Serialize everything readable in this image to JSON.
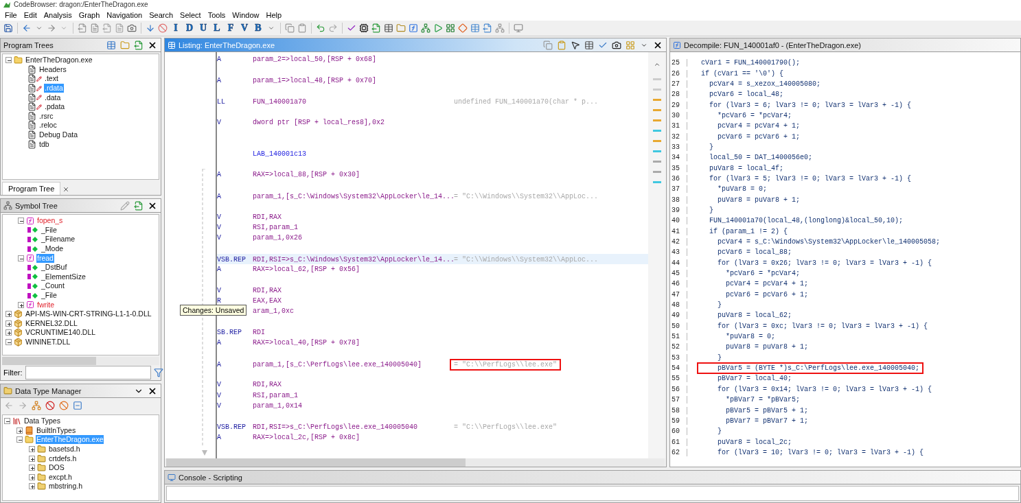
{
  "window": {
    "title": "CodeBrowser: dragon:/EnterTheDragon.exe"
  },
  "menu": [
    "File",
    "Edit",
    "Analysis",
    "Graph",
    "Navigation",
    "Search",
    "Select",
    "Tools",
    "Window",
    "Help"
  ],
  "toolbar_letters": [
    "I",
    "D",
    "U",
    "L",
    "F",
    "V",
    "B"
  ],
  "program_trees": {
    "title": "Program Trees",
    "tab": "Program Tree",
    "nodes": [
      {
        "label": "EnterTheDragon.exe",
        "kind": "program",
        "expanded": true,
        "selected": false,
        "children": [
          {
            "label": "Headers",
            "kind": "fragment",
            "flagged": false,
            "selected": false
          },
          {
            "label": ".text",
            "kind": "fragment",
            "flagged": true,
            "selected": false
          },
          {
            "label": ".rdata",
            "kind": "fragment",
            "flagged": true,
            "selected": true
          },
          {
            "label": ".data",
            "kind": "fragment",
            "flagged": true,
            "selected": false
          },
          {
            "label": ".pdata",
            "kind": "fragment",
            "flagged": true,
            "selected": false
          },
          {
            "label": ".rsrc",
            "kind": "fragment",
            "flagged": false,
            "selected": false
          },
          {
            "label": ".reloc",
            "kind": "fragment",
            "flagged": false,
            "selected": false
          },
          {
            "label": "Debug Data",
            "kind": "fragment",
            "flagged": false,
            "selected": false
          },
          {
            "label": "tdb",
            "kind": "fragment",
            "flagged": false,
            "selected": false
          }
        ]
      }
    ]
  },
  "symbol_tree": {
    "title": "Symbol Tree",
    "filter_label": "Filter:",
    "nodes": [
      {
        "label": "fopen_s",
        "kind": "function",
        "expanded": true,
        "selected": false,
        "children": [
          {
            "label": "_File",
            "kind": "parameter",
            "selected": false
          },
          {
            "label": "_Filename",
            "kind": "parameter",
            "selected": false
          },
          {
            "label": "_Mode",
            "kind": "parameter",
            "selected": false
          }
        ]
      },
      {
        "label": "fread",
        "kind": "function",
        "expanded": true,
        "selected": true,
        "children": [
          {
            "label": "_DstBuf",
            "kind": "parameter",
            "selected": false
          },
          {
            "label": "_ElementSize",
            "kind": "parameter",
            "selected": false
          },
          {
            "label": "_Count",
            "kind": "parameter",
            "selected": false
          },
          {
            "label": "_File",
            "kind": "parameter",
            "selected": false
          }
        ]
      },
      {
        "label": "fwrite",
        "kind": "function",
        "expanded": false,
        "selected": false
      },
      {
        "label": "API-MS-WIN-CRT-STRING-L1-1-0.DLL",
        "kind": "library",
        "expanded": false,
        "selected": false
      },
      {
        "label": "KERNEL32.DLL",
        "kind": "library",
        "expanded": false,
        "selected": false
      },
      {
        "label": "VCRUNTIME140.DLL",
        "kind": "library",
        "expanded": false,
        "selected": false
      },
      {
        "label": "WININET.DLL",
        "kind": "library",
        "expanded": true,
        "selected": false
      }
    ]
  },
  "data_type_manager": {
    "title": "Data Type Manager",
    "nodes": [
      {
        "label": "Data Types",
        "kind": "root",
        "expanded": true,
        "selected": false,
        "children": [
          {
            "label": "BuiltInTypes",
            "kind": "archive",
            "expanded": false,
            "selected": false
          },
          {
            "label": "EnterTheDragon.exe",
            "kind": "program",
            "expanded": true,
            "selected": true,
            "children": [
              {
                "label": "basetsd.h",
                "kind": "folder",
                "expanded": false,
                "selected": false
              },
              {
                "label": "crtdefs.h",
                "kind": "folder",
                "expanded": false,
                "selected": false
              },
              {
                "label": "DOS",
                "kind": "folder",
                "expanded": false,
                "selected": false
              },
              {
                "label": "excpt.h",
                "kind": "folder",
                "expanded": false,
                "selected": false
              },
              {
                "label": "mbstring.h",
                "kind": "folder",
                "expanded": false,
                "selected": false
              }
            ]
          }
        ]
      }
    ]
  },
  "listing": {
    "title": "Listing:  EnterTheDragon.exe",
    "tooltip": "Changes: Unsaved",
    "rows": [
      {
        "kind": "code",
        "mnemonic": "A",
        "operands": "param_2=>local_50,[RSP + 0x68]",
        "current": false
      },
      {
        "kind": "blank"
      },
      {
        "kind": "code",
        "mnemonic": "A",
        "operands": "param_1=>local_48,[RSP + 0x70]",
        "current": false
      },
      {
        "kind": "blank"
      },
      {
        "kind": "code",
        "mnemonic": "LL",
        "operands": "FUN_140001a70",
        "comment": "undefined FUN_140001a70(char * p...",
        "current": false
      },
      {
        "kind": "blank"
      },
      {
        "kind": "code",
        "mnemonic": "V",
        "operands": "dword ptr [RSP + local_res8],0x2",
        "current": false
      },
      {
        "kind": "blank"
      },
      {
        "kind": "blank"
      },
      {
        "kind": "label",
        "operands": "LAB_140001c13",
        "current": false
      },
      {
        "kind": "blank"
      },
      {
        "kind": "code",
        "mnemonic": "A",
        "operands": "RAX=>local_88,[RSP + 0x30]",
        "current": false
      },
      {
        "kind": "blank"
      },
      {
        "kind": "code",
        "mnemonic": "A",
        "operands": "param_1,[s_C:\\Windows\\System32\\AppLocker\\le_14...",
        "comment": "= \"C:\\\\Windows\\\\System32\\\\AppLoc...",
        "current": false
      },
      {
        "kind": "blank"
      },
      {
        "kind": "code",
        "mnemonic": "V",
        "operands": "RDI,RAX",
        "current": false
      },
      {
        "kind": "code",
        "mnemonic": "V",
        "operands": "RSI,param_1",
        "current": false
      },
      {
        "kind": "code",
        "mnemonic": "V",
        "operands": "param_1,0x26",
        "current": false
      },
      {
        "kind": "blank"
      },
      {
        "kind": "code",
        "mnemonic": "VSB.REP",
        "operands": "RDI,RSI=>s_C:\\Windows\\System32\\AppLocker\\le_14...",
        "comment": "= \"C:\\\\Windows\\\\System32\\\\AppLoc...",
        "current": true
      },
      {
        "kind": "code",
        "mnemonic": "A",
        "operands": "RAX=>local_62,[RSP + 0x56]",
        "current": false
      },
      {
        "kind": "blank"
      },
      {
        "kind": "code",
        "mnemonic": "V",
        "operands": "RDI,RAX",
        "current": false
      },
      {
        "kind": "code",
        "mnemonic": "R",
        "operands": "EAX,EAX",
        "current": false
      },
      {
        "kind": "code",
        "operands": "aram_1,0xc",
        "current": false
      },
      {
        "kind": "blank"
      },
      {
        "kind": "code",
        "mnemonic": "SB.REP",
        "operands": "RDI",
        "current": false
      },
      {
        "kind": "code",
        "mnemonic": "A",
        "operands": "RAX=>local_40,[RSP + 0x78]",
        "current": false
      },
      {
        "kind": "blank"
      },
      {
        "kind": "code",
        "mnemonic": "A",
        "operands": "param_1,[s_C:\\PerfLogs\\lee.exe_140005040]",
        "comment": "= \"C:\\\\PerfLogs\\\\lee.exe\"",
        "boxed": true,
        "current": false
      },
      {
        "kind": "blank"
      },
      {
        "kind": "code",
        "mnemonic": "V",
        "operands": "RDI,RAX",
        "current": false
      },
      {
        "kind": "code",
        "mnemonic": "V",
        "operands": "RSI,param_1",
        "current": false
      },
      {
        "kind": "code",
        "mnemonic": "V",
        "operands": "param_1,0x14",
        "current": false
      },
      {
        "kind": "blank"
      },
      {
        "kind": "code",
        "mnemonic": "VSB.REP",
        "operands": "RDI,RSI=>s_C:\\PerfLogs\\lee.exe_140005040",
        "comment": "= \"C:\\\\PerfLogs\\\\lee.exe\"",
        "current": false
      },
      {
        "kind": "code",
        "mnemonic": "A",
        "operands": "RAX=>local_2c,[RSP + 0x8c]",
        "current": false
      }
    ]
  },
  "decompile": {
    "title": "Decompile: FUN_140001af0 -  (EnterTheDragon.exe)",
    "lines": [
      {
        "n": "25",
        "code": "cVar1 = FUN_140001790();"
      },
      {
        "n": "26",
        "code": "if (cVar1 == '\\0') {"
      },
      {
        "n": "27",
        "code": "  pcVar4 = s_xezox_140005080;"
      },
      {
        "n": "28",
        "code": "  pcVar6 = local_48;"
      },
      {
        "n": "29",
        "code": "  for (lVar3 = 6; lVar3 != 0; lVar3 = lVar3 + -1) {"
      },
      {
        "n": "30",
        "code": "    *pcVar6 = *pcVar4;"
      },
      {
        "n": "31",
        "code": "    pcVar4 = pcVar4 + 1;"
      },
      {
        "n": "32",
        "code": "    pcVar6 = pcVar6 + 1;"
      },
      {
        "n": "33",
        "code": "  }"
      },
      {
        "n": "34",
        "code": "  local_50 = DAT_1400056e0;"
      },
      {
        "n": "35",
        "code": "  puVar8 = local_4f;"
      },
      {
        "n": "36",
        "code": "  for (lVar3 = 5; lVar3 != 0; lVar3 = lVar3 + -1) {"
      },
      {
        "n": "37",
        "code": "    *puVar8 = 0;"
      },
      {
        "n": "38",
        "code": "    puVar8 = puVar8 + 1;"
      },
      {
        "n": "39",
        "code": "  }"
      },
      {
        "n": "40",
        "code": "  FUN_140001a70(local_48,(longlong)&local_50,10);"
      },
      {
        "n": "41",
        "code": "  if (param_1 != 2) {"
      },
      {
        "n": "42",
        "code": "    pcVar4 = s_C:\\Windows\\System32\\AppLocker\\le_140005058;"
      },
      {
        "n": "43",
        "code": "    pcVar6 = local_88;"
      },
      {
        "n": "44",
        "code": "    for (lVar3 = 0x26; lVar3 != 0; lVar3 = lVar3 + -1) {"
      },
      {
        "n": "45",
        "code": "      *pcVar6 = *pcVar4;"
      },
      {
        "n": "46",
        "code": "      pcVar4 = pcVar4 + 1;"
      },
      {
        "n": "47",
        "code": "      pcVar6 = pcVar6 + 1;"
      },
      {
        "n": "48",
        "code": "    }"
      },
      {
        "n": "49",
        "code": "    puVar8 = local_62;"
      },
      {
        "n": "50",
        "code": "    for (lVar3 = 0xc; lVar3 != 0; lVar3 = lVar3 + -1) {"
      },
      {
        "n": "51",
        "code": "      *puVar8 = 0;"
      },
      {
        "n": "52",
        "code": "      puVar8 = puVar8 + 1;"
      },
      {
        "n": "53",
        "code": "    }"
      },
      {
        "n": "54",
        "code": "    pBVar5 = (BYTE *)s_C:\\PerfLogs\\lee.exe_140005040;",
        "boxed": true
      },
      {
        "n": "55",
        "code": "    pBVar7 = local_40;"
      },
      {
        "n": "56",
        "code": "    for (lVar3 = 0x14; lVar3 != 0; lVar3 = lVar3 + -1) {"
      },
      {
        "n": "57",
        "code": "      *pBVar7 = *pBVar5;"
      },
      {
        "n": "58",
        "code": "      pBVar5 = pBVar5 + 1;"
      },
      {
        "n": "59",
        "code": "      pBVar7 = pBVar7 + 1;"
      },
      {
        "n": "60",
        "code": "    }"
      },
      {
        "n": "61",
        "code": "    puVar8 = local_2c;"
      },
      {
        "n": "62",
        "code": "    for (lVar3 = 10; lVar3 != 0; lVar3 = lVar3 + -1) {"
      }
    ]
  },
  "console": {
    "title": "Console - Scripting"
  }
}
